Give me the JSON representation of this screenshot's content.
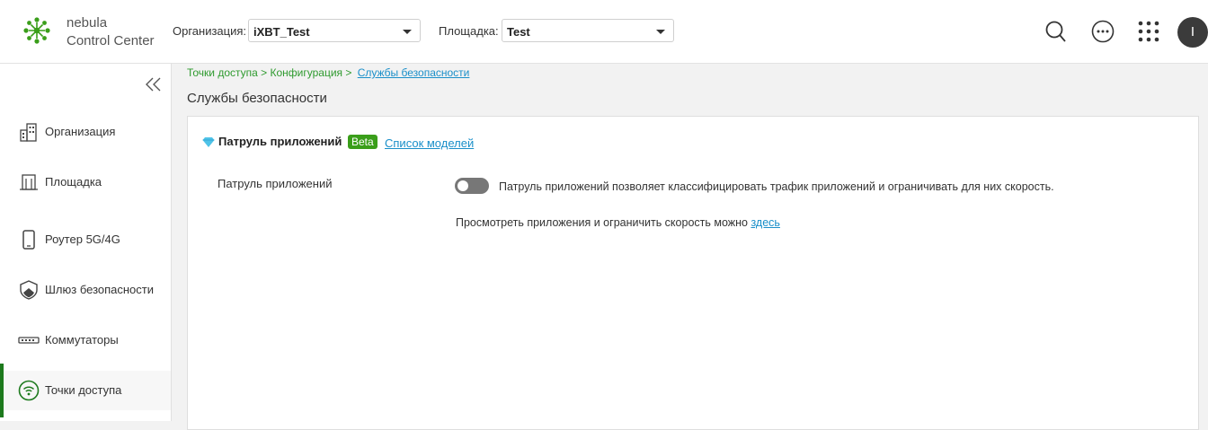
{
  "header": {
    "brand_line1": "nebula",
    "brand_line2": "Control Center",
    "org_label": "Организация:",
    "org_value": "iXBT_Test",
    "site_label": "Площадка:",
    "site_value": "Test",
    "avatar_initial": "I",
    "icons": [
      "search-icon",
      "more-icon",
      "apps-grid-icon"
    ]
  },
  "sidebar": {
    "items": [
      {
        "label": "Организация",
        "icon": "building-icon"
      },
      {
        "label": "Площадка",
        "icon": "site-icon"
      },
      {
        "label": "Роутер 5G/4G",
        "icon": "mobile-router-icon"
      },
      {
        "label": "Шлюз безопасности",
        "icon": "shield-icon"
      },
      {
        "label": "Коммутаторы",
        "icon": "switch-icon"
      },
      {
        "label": "Точки доступа",
        "icon": "wifi-icon",
        "active": true
      }
    ]
  },
  "breadcrumb": {
    "part1": "Точки доступа > Конфигурация >",
    "current": "Службы безопасности"
  },
  "page": {
    "title": "Службы безопасности"
  },
  "panel": {
    "title": "Патруль приложений",
    "badge": "Beta",
    "models_link": "Список моделей",
    "row_label": "Патруль приложений",
    "toggle_state": "off",
    "description": "Патруль приложений позволяет классифицировать трафик приложений и ограничивать для них скорость.",
    "view_text": "Просмотреть приложения и ограничить скорость можно",
    "view_link": "здесь"
  },
  "colors": {
    "accent_green": "#1d7a1d",
    "link_blue": "#1a8fc9",
    "badge_green": "#3a9e1a"
  }
}
